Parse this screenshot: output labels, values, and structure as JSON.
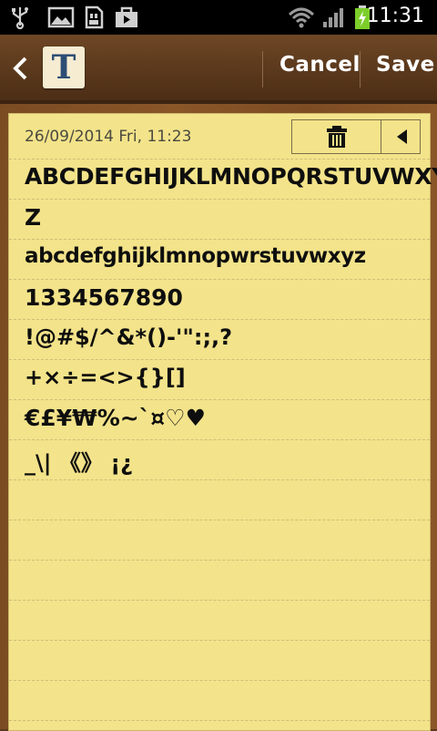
{
  "status_bar": {
    "icons": [
      "usb-icon",
      "image-icon",
      "sd-card-icon",
      "bag-icon",
      "wifi-icon",
      "signal-icon",
      "battery-charging-icon"
    ],
    "time": "11:31"
  },
  "action_bar": {
    "back_icon": "chevron-left-icon",
    "app_icon_letter": "T",
    "cancel_label": "Cancel",
    "save_label": "Save"
  },
  "note": {
    "datetime": "26/09/2014 Fri, 11:23",
    "toolbar_icons": [
      "trash-icon",
      "arrow-left-icon"
    ],
    "lines": [
      "ABCDEFGHIJKLMNOPQRSTUVWXY",
      "Z",
      "abcdefghijklmnopwrstuvwxyz",
      "1334567890",
      "!@#$/^&*()-'\":;,?",
      "+×÷=<>{}[]",
      "€£¥₩%~`¤♡♥",
      "_\\| 《》 ¡¿"
    ]
  }
}
